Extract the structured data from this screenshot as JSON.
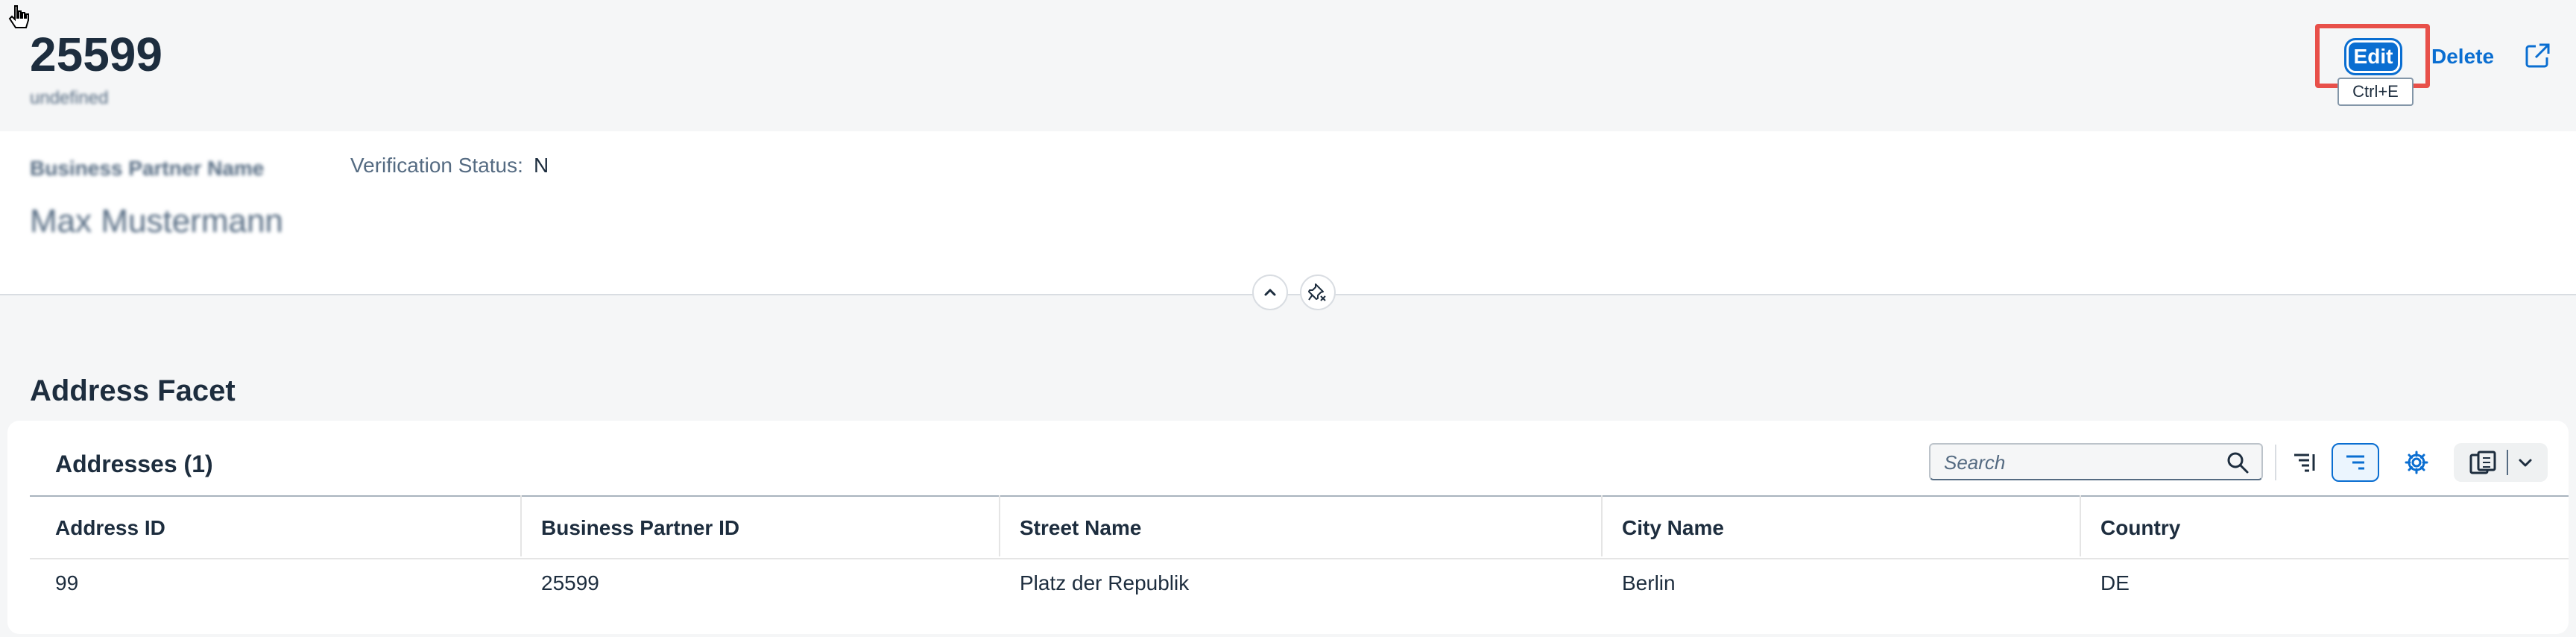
{
  "header": {
    "title": "25599",
    "subtitle": "undefined"
  },
  "actions": {
    "edit_label": "Edit",
    "edit_tooltip": "Ctrl+E",
    "delete_label": "Delete"
  },
  "header_content": {
    "bp_name_label": "Business Partner Name",
    "bp_name_value": "Max Mustermann",
    "verification_label": "Verification Status:",
    "verification_value": "N"
  },
  "section": {
    "title": "Address Facet"
  },
  "table": {
    "title": "Addresses (1)",
    "search_placeholder": "Search",
    "columns": [
      "Address ID",
      "Business Partner ID",
      "Street Name",
      "City Name",
      "Country"
    ],
    "rows": [
      [
        "99",
        "25599",
        "Platz der Republik",
        "Berlin",
        "DE"
      ]
    ]
  },
  "colors": {
    "accent": "#0a6ed1",
    "highlight": "#e8504a",
    "text": "#1d2d3e",
    "muted": "#556b82"
  },
  "icons": [
    "cursor-icon",
    "share-icon",
    "collapse-icon",
    "unpin-icon",
    "search-icon",
    "sort-icon",
    "group-icon",
    "settings-icon",
    "export-icon",
    "chevron-down-icon"
  ]
}
